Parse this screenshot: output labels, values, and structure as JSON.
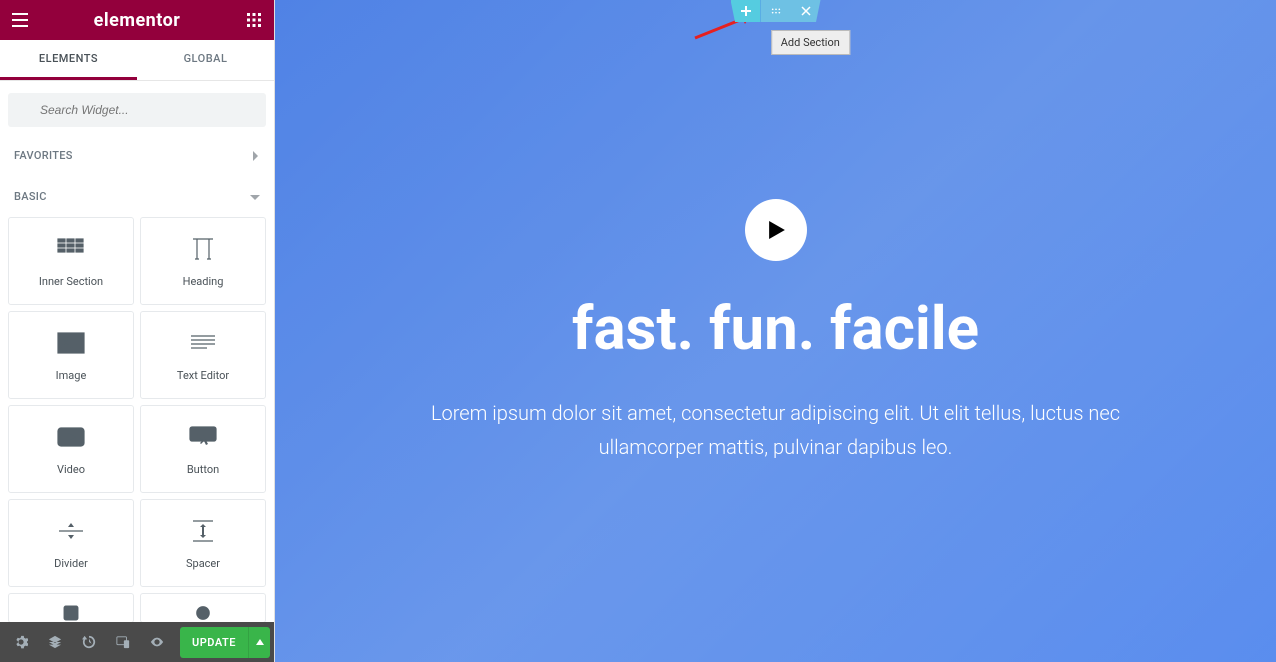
{
  "brand": "elementor",
  "tabs": {
    "elements": "ELEMENTS",
    "global": "GLOBAL"
  },
  "search": {
    "placeholder": "Search Widget..."
  },
  "categories": {
    "favorites": "FAVORITES",
    "basic": "BASIC"
  },
  "widgets": {
    "inner_section": "Inner Section",
    "heading": "Heading",
    "image": "Image",
    "text_editor": "Text Editor",
    "video": "Video",
    "button": "Button",
    "divider": "Divider",
    "spacer": "Spacer"
  },
  "footer": {
    "update": "UPDATE"
  },
  "section_handle": {
    "tooltip": "Add Section"
  },
  "hero": {
    "title": "fast. fun. facile",
    "text": "Lorem ipsum dolor sit amet, consectetur adipiscing elit. Ut elit tellus, luctus nec ullamcorper mattis, pulvinar dapibus leo."
  }
}
